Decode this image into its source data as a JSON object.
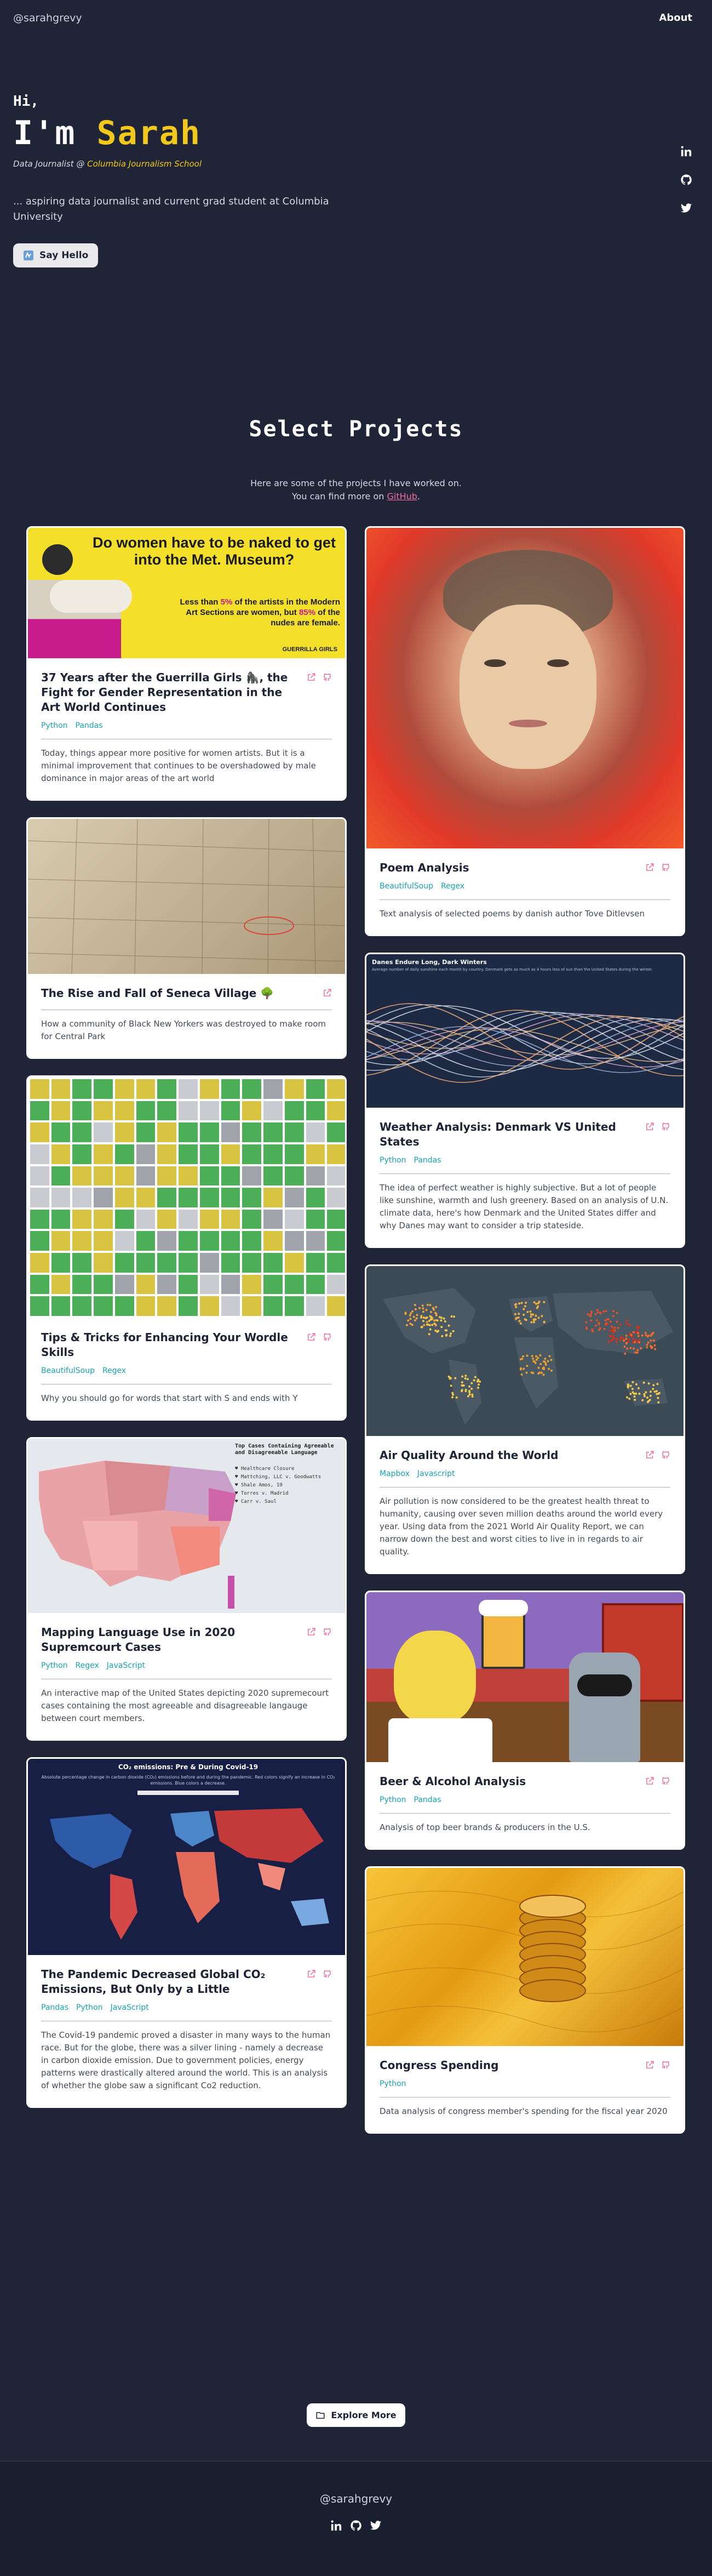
{
  "nav": {
    "brand": "@sarahgrevy",
    "about": "About"
  },
  "hero": {
    "hi": "Hi,",
    "name_prefix": "I'm ",
    "name": "Sarah",
    "role_prefix": "Data Journalist @ ",
    "school": "Columbia Journalism School",
    "bio": "... aspiring data journalist and current grad student at Columbia University",
    "cta": "Say Hello"
  },
  "social": [
    "linkedin-icon",
    "github-icon",
    "twitter-icon"
  ],
  "projects_section": {
    "title": "Select Projects",
    "intro_line1": "Here are some of the projects I have worked on.",
    "intro_line2_prefix": "You can find more on ",
    "intro_link": "GitHub",
    "intro_line2_suffix": "."
  },
  "image_text": {
    "guerrilla_headline": "Do women have to be naked to get into the Met. Museum?",
    "guerrilla_body_1": "Less than ",
    "guerrilla_pct_artists": "5%",
    "guerrilla_body_2": " of the artists in the Modern Art Sections are women, but ",
    "guerrilla_pct_nudes": "85%",
    "guerrilla_body_3": " of the nudes are female.",
    "guerrilla_sig": "GUERRILLA GIRLS",
    "weather_title": "Danes Endure Long, Dark Winters",
    "weather_sub": "Average number of daily sunshine each month by country. Denmark gets as much as 4 hours less of sun than the United States during the winter.",
    "map_title": "Top Cases Containing Agreeable and Disagreeable Language",
    "map_items": [
      "Healthcare Closure",
      "Mattching, LLC v. Goodwatts",
      "Shale Amos, 19",
      "Torres v. Madrid",
      "Carr v. Saul"
    ],
    "co2_title": "CO₂ emissions: Pre & During Covid-19",
    "co2_sub": "Absolute percentage change in carbon dioxide (CO₂) emissions before and during the pandemic. Red colors signify an increase in CO₂ emissions. Blue colors a decrease."
  },
  "left_projects": [
    {
      "title": "37 Years after the Guerrilla Girls 🦍, the Fight for Gender Representation in the Art World Continues",
      "tags": [
        "Python",
        "Pandas"
      ],
      "desc": "Today, things appear more positive for women artists. But it is a minimal improvement that continues to be overshadowed by male dominance in major areas of the art world"
    },
    {
      "title": "The Rise and Fall of Seneca Village 🌳",
      "tags": [],
      "desc": "How a community of Black New Yorkers was destroyed to make room for Central Park"
    },
    {
      "title": "Tips & Tricks for Enhancing Your Wordle Skills",
      "tags": [
        "BeautifulSoup",
        "Regex"
      ],
      "desc": "Why you should go for words that start with S and ends with Y"
    },
    {
      "title": "Mapping Language Use in 2020 Supremcourt Cases",
      "tags": [
        "Python",
        "Regex",
        "JavaScript"
      ],
      "desc": "An interactive map of the United States depicting 2020 supremecourt cases containing the most agreeable and disagreeable langauge between court members."
    },
    {
      "title": "The Pandemic Decreased Global CO₂ Emissions, But Only by a Little",
      "tags": [
        "Pandas",
        "Python",
        "JavaScript"
      ],
      "desc": "The Covid-19 pandemic proved a disaster in many ways to the human race. But for the globe, there was a silver lining - namely a decrease in carbon dioxide emission. Due to government policies, energy patterns were drastically altered around the world. This is an analysis of whether the globe saw a significant Co2 reduction."
    }
  ],
  "right_projects": [
    {
      "title": "Poem Analysis",
      "tags": [
        "BeautifulSoup",
        "Regex"
      ],
      "desc": "Text analysis of selected poems by danish author Tove Ditlevsen"
    },
    {
      "title": "Weather Analysis: Denmark VS United States",
      "tags": [
        "Python",
        "Pandas"
      ],
      "desc": "The idea of perfect weather is highly subjective. But a lot of people like sunshine, warmth and lush greenery. Based on an analysis of U.N. climate data, here's how Denmark and the United States differ and why Danes may want to consider a trip stateside."
    },
    {
      "title": "Air Quality Around the World",
      "tags": [
        "Mapbox",
        "Javascript"
      ],
      "desc": "Air pollution is now considered to be the greatest health threat to humanity, causing over seven million deaths around the world every year. Using data from the 2021 World Air Quality Report, we can narrow down the best and worst cities to live in in regards to air quality."
    },
    {
      "title": "Beer & Alcohol Analysis",
      "tags": [
        "Python",
        "Pandas"
      ],
      "desc": "Analysis of top beer brands & producers in the U.S."
    },
    {
      "title": "Congress Spending",
      "tags": [
        "Python"
      ],
      "desc": "Data analysis of congress member's spending for the fiscal year 2020"
    }
  ],
  "footer": {
    "explore": "Explore More",
    "handle": "@sarahgrevy"
  },
  "colors": {
    "background": "#1f2437",
    "accent_yellow": "#f2c81d",
    "accent_pink": "#f06aa0",
    "tag_teal": "#1aa3b5"
  }
}
